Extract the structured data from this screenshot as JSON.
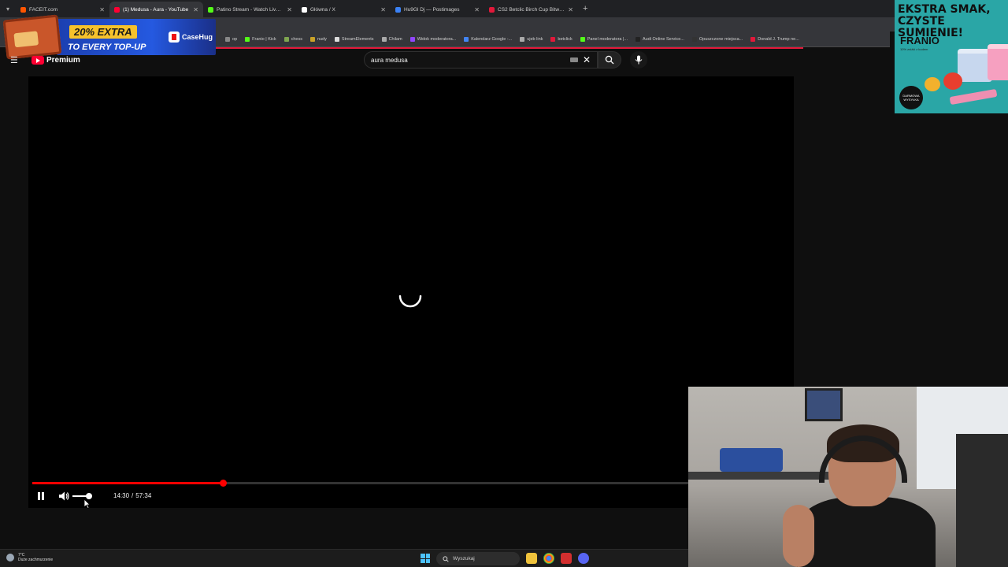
{
  "browser": {
    "tabs": [
      {
        "title": "FACEIT.com",
        "color": "#ff5500",
        "active": false
      },
      {
        "title": "(1) Medusa - Aura - YouTube",
        "color": "#ff0033",
        "active": true
      },
      {
        "title": "Patino Stream - Watch Live on Kick",
        "color": "#53fc18",
        "active": false
      },
      {
        "title": "Główna / X",
        "color": "#ffffff",
        "active": false
      },
      {
        "title": "Hu9Gl Dj — Postimages",
        "color": "#3b82f6",
        "active": false
      },
      {
        "title": "CS2 Betclic Birch Cup Bitwa Str...",
        "color": "#e2183a",
        "active": false
      }
    ],
    "close_glyph": "✕",
    "newtab_glyph": "+",
    "bookmarks": [
      {
        "label": "op",
        "color": "#888888"
      },
      {
        "label": "Franio | Kick",
        "color": "#53fc18"
      },
      {
        "label": "chess",
        "color": "#7fa650"
      },
      {
        "label": "nudy",
        "color": "#c9a227"
      },
      {
        "label": "StreamElements",
        "color": "#dddddd"
      },
      {
        "label": "Chilam",
        "color": "#aaaaaa"
      },
      {
        "label": "Widok moderatora...",
        "color": "#9146ff"
      },
      {
        "label": "Kalendarz Google -...",
        "color": "#4285f4"
      },
      {
        "label": "ujeb link",
        "color": "#aaaaaa"
      },
      {
        "label": "betclick",
        "color": "#e2183a"
      },
      {
        "label": "Panel moderatora |...",
        "color": "#53fc18"
      },
      {
        "label": "Audi Online Service...",
        "color": "#222222"
      },
      {
        "label": "Opuszczone miejsca...",
        "color": "#333333"
      },
      {
        "label": "Donald J. Trump ne...",
        "color": "#e2183a"
      }
    ]
  },
  "ad_overlay": {
    "line1": "20% EXTRA",
    "line2": "TO EVERY TOP-UP",
    "brand": "CaseHug"
  },
  "youtube": {
    "menu_icon": "☰",
    "logo_text": "Premium",
    "search_query": "aura medusa",
    "clear_glyph": "✕",
    "player": {
      "current_time": "14:30",
      "separator": "/",
      "duration": "57:34",
      "progress_fraction": 0.29,
      "volume_fraction": 0.8,
      "state": "paused-buffering"
    },
    "colors": {
      "accent": "#ff0000"
    }
  },
  "promo_ad": {
    "headline": "EKSTRA SMAK, CZYSTE SUMIENIE!",
    "brand": "FRANIO",
    "subline": "10% zniżki z kodem",
    "badge": "DARMOWA WYSYŁKA"
  },
  "taskbar": {
    "weather_temp": "7°C",
    "weather_desc": "Duże zachmurzenie",
    "search_placeholder": "Wyszukaj"
  }
}
